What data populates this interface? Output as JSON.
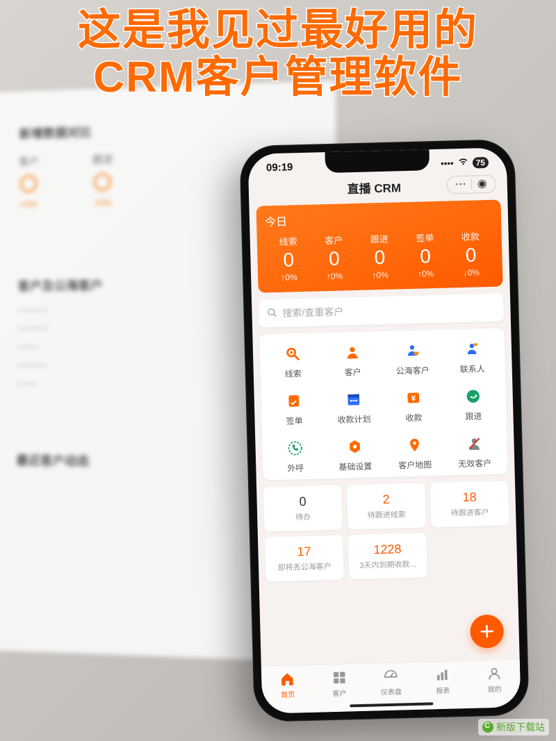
{
  "overlay": {
    "headline_line1": "这是我见过最好用的",
    "headline_line2": "CRM客户管理软件"
  },
  "background_panel": {
    "section1_title": "新增数据对比",
    "metrics": [
      {
        "label": "客户",
        "rate": "+0%"
      },
      {
        "label": "跟进",
        "rate": "+0%"
      }
    ],
    "section2_title": "客户及公海客户",
    "section3_title": "最近客户动态"
  },
  "status_bar": {
    "time": "09:19",
    "battery": "75"
  },
  "nav": {
    "title": "直播 CRM"
  },
  "hero": {
    "title": "今日",
    "cells": [
      {
        "label": "线索",
        "value": "0",
        "rate": "↑0%"
      },
      {
        "label": "客户",
        "value": "0",
        "rate": "↑0%"
      },
      {
        "label": "跟进",
        "value": "0",
        "rate": "↑0%"
      },
      {
        "label": "签单",
        "value": "0",
        "rate": "↑0%"
      },
      {
        "label": "收款",
        "value": "0",
        "rate": "↓0%"
      }
    ]
  },
  "search": {
    "placeholder": "搜索/查重客户"
  },
  "apps": [
    {
      "label": "线索",
      "icon": "lead-icon",
      "color": "#ff6a00"
    },
    {
      "label": "客户",
      "icon": "customer-icon",
      "color": "#ff6a00"
    },
    {
      "label": "公海客户",
      "icon": "public-pool-icon",
      "color": "#2f6df6"
    },
    {
      "label": "联系人",
      "icon": "contact-icon",
      "color": "#2f6df6"
    },
    {
      "label": "签单",
      "icon": "contract-icon",
      "color": "#ff6a00"
    },
    {
      "label": "收款计划",
      "icon": "plan-icon",
      "color": "#2f6df6"
    },
    {
      "label": "收款",
      "icon": "payment-icon",
      "color": "#ff6a00"
    },
    {
      "label": "跟进",
      "icon": "followup-icon",
      "color": "#1aa06a"
    },
    {
      "label": "外呼",
      "icon": "call-icon",
      "color": "#1aa06a"
    },
    {
      "label": "基础设置",
      "icon": "settings-icon",
      "color": "#ff6a00"
    },
    {
      "label": "客户地图",
      "icon": "map-icon",
      "color": "#ff6a00"
    },
    {
      "label": "无效客户",
      "icon": "invalid-icon",
      "color": "#7a8a8a"
    }
  ],
  "stats": [
    {
      "value": "0",
      "label": "待办",
      "color": "v-black"
    },
    {
      "value": "2",
      "label": "待跟进线索",
      "color": "v-orange"
    },
    {
      "value": "18",
      "label": "待跟进客户",
      "color": "v-orange"
    },
    {
      "value": "17",
      "label": "即将丢公海客户",
      "color": "v-orange"
    },
    {
      "value": "1228",
      "label": "3天内到期收款...",
      "color": "v-orange"
    }
  ],
  "tabs": [
    {
      "label": "首页",
      "icon": "home-icon",
      "active": true
    },
    {
      "label": "客户",
      "icon": "users-icon",
      "active": false
    },
    {
      "label": "仪表盘",
      "icon": "dashboard-icon",
      "active": false
    },
    {
      "label": "报表",
      "icon": "report-icon",
      "active": false
    },
    {
      "label": "我的",
      "icon": "me-icon",
      "active": false
    }
  ],
  "watermark": "新版下载站"
}
